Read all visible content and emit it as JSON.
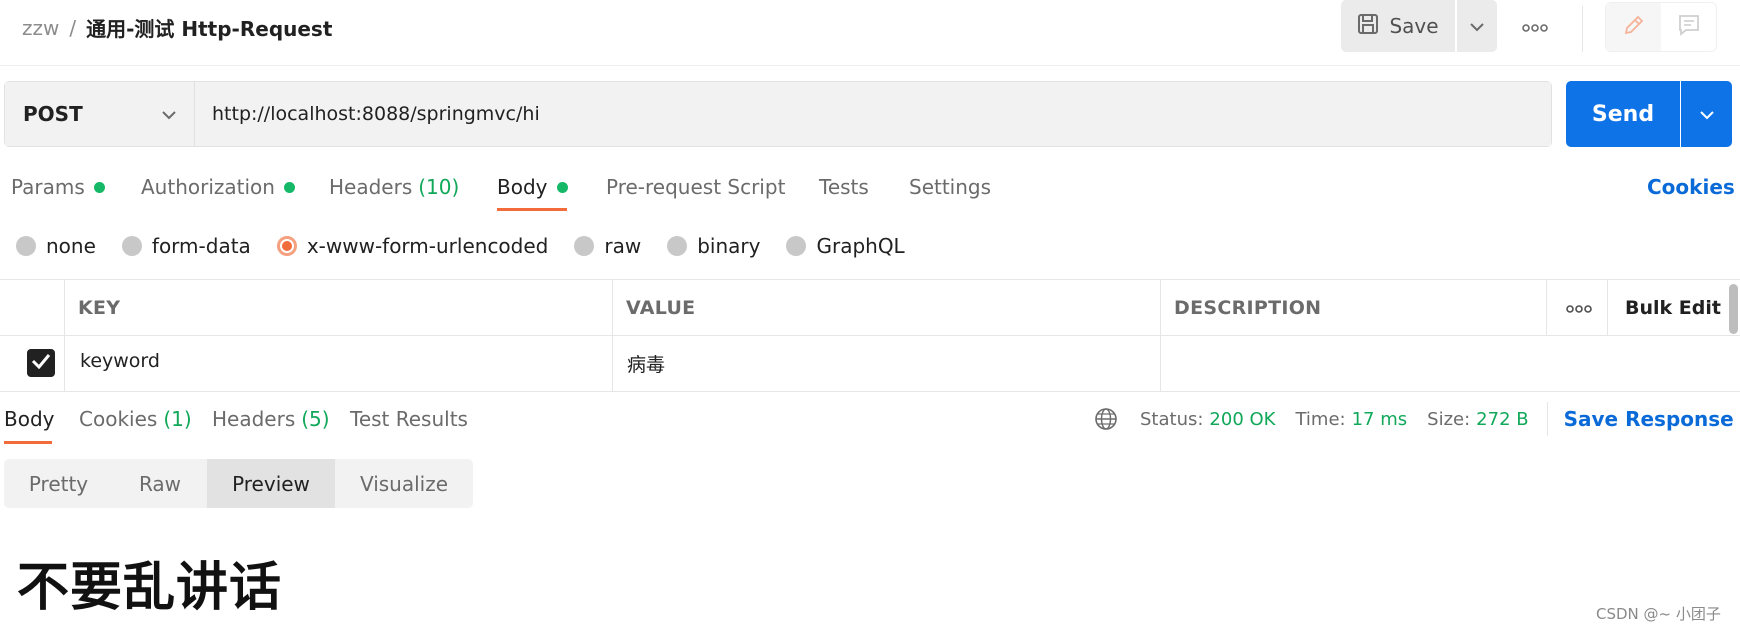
{
  "breadcrumb": {
    "workspace": "zzw",
    "separator": "/",
    "request_name": "通用-测试 Http-Request"
  },
  "toolbar": {
    "save_label": "Save"
  },
  "request": {
    "method": "POST",
    "url": "http://localhost:8088/springmvc/hi",
    "send_label": "Send"
  },
  "request_tabs": [
    {
      "label": "Params",
      "count": ""
    },
    {
      "label": "Authorization",
      "count": ""
    },
    {
      "label": "Headers",
      "count": "(10)"
    },
    {
      "label": "Body",
      "count": ""
    },
    {
      "label": "Pre-request Script",
      "count": ""
    },
    {
      "label": "Tests",
      "count": ""
    },
    {
      "label": "Settings",
      "count": ""
    }
  ],
  "cookies_link": "Cookies",
  "body_types": [
    {
      "label": "none"
    },
    {
      "label": "form-data"
    },
    {
      "label": "x-www-form-urlencoded"
    },
    {
      "label": "raw"
    },
    {
      "label": "binary"
    },
    {
      "label": "GraphQL"
    }
  ],
  "params_table": {
    "headers": {
      "key": "KEY",
      "value": "VALUE",
      "description": "DESCRIPTION",
      "bulk_edit": "Bulk Edit"
    },
    "rows": [
      {
        "key": "keyword",
        "value": "病毒",
        "description": ""
      }
    ]
  },
  "response_tabs": [
    {
      "label": "Body",
      "count": ""
    },
    {
      "label": "Cookies",
      "count": "(1)"
    },
    {
      "label": "Headers",
      "count": "(5)"
    },
    {
      "label": "Test Results",
      "count": ""
    }
  ],
  "response_status": {
    "status_label": "Status:",
    "status_value": "200 OK",
    "time_label": "Time:",
    "time_value": "17 ms",
    "size_label": "Size:",
    "size_value": "272 B",
    "save_response": "Save Response"
  },
  "view_tabs": [
    {
      "label": "Pretty"
    },
    {
      "label": "Raw"
    },
    {
      "label": "Preview"
    },
    {
      "label": "Visualize"
    }
  ],
  "preview_content": "不要乱讲话",
  "watermark": "CSDN @~ 小团子",
  "colors": {
    "accent_orange": "#f26b3a",
    "send_blue": "#0f73e8",
    "link_blue": "#0a6bd8",
    "success_green": "#11a85a",
    "dot_green": "#14b866"
  }
}
